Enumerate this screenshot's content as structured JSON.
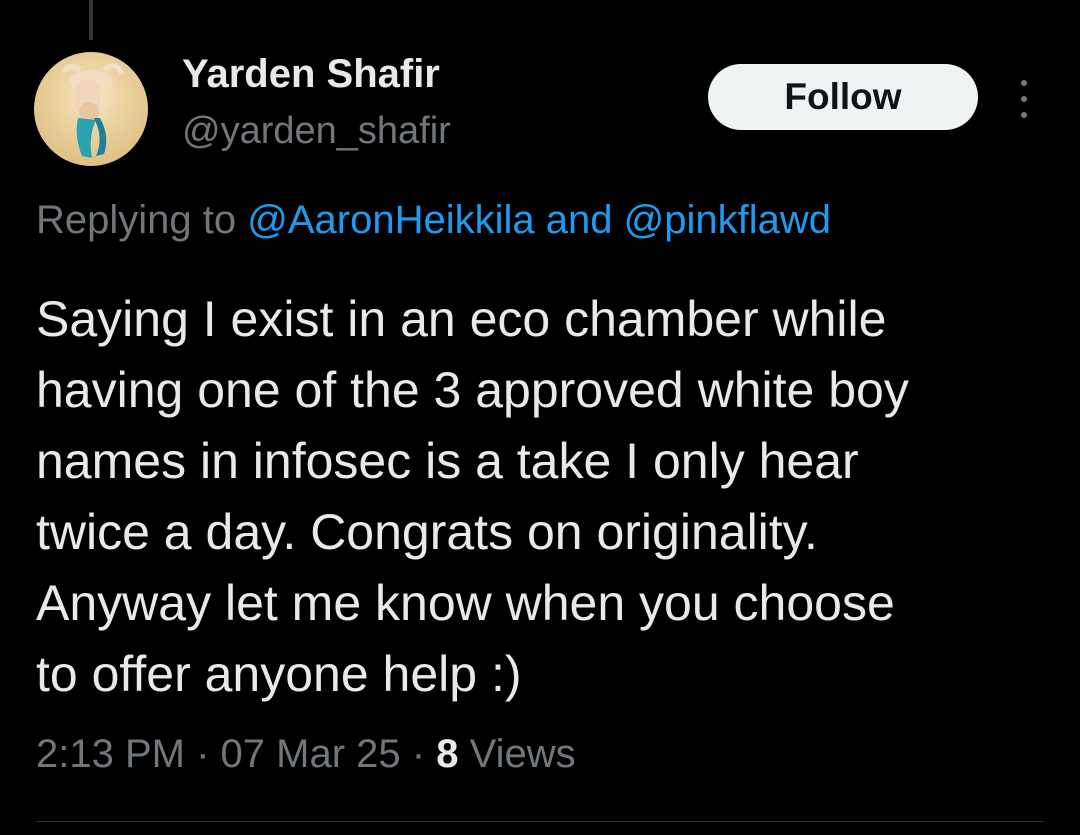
{
  "author": {
    "display_name": "Yarden Shafir",
    "handle": "@yarden_shafir"
  },
  "actions": {
    "follow_label": "Follow",
    "more_icon": "more-vertical-icon"
  },
  "reply_context": {
    "prefix": "Replying to",
    "mention_1": "@AaronHeikkila",
    "conjunction": "and",
    "mention_2": "@pinkflawd"
  },
  "tweet": {
    "lines": [
      "Saying I exist in an eco chamber while",
      "having one of the 3 approved white boy",
      "names in infosec is a take I only hear",
      "twice a day. Congrats on originality.",
      "Anyway let me know when you choose",
      "to offer anyone help :)"
    ],
    "time": "2:13 PM",
    "separator": "·",
    "date": "07 Mar 25",
    "views_count": "8",
    "views_label": "Views"
  },
  "colors": {
    "background": "#000000",
    "text": "#e7e9ea",
    "secondary": "#71767b",
    "link": "#1d9bf0",
    "button_bg": "#eff3f4"
  }
}
